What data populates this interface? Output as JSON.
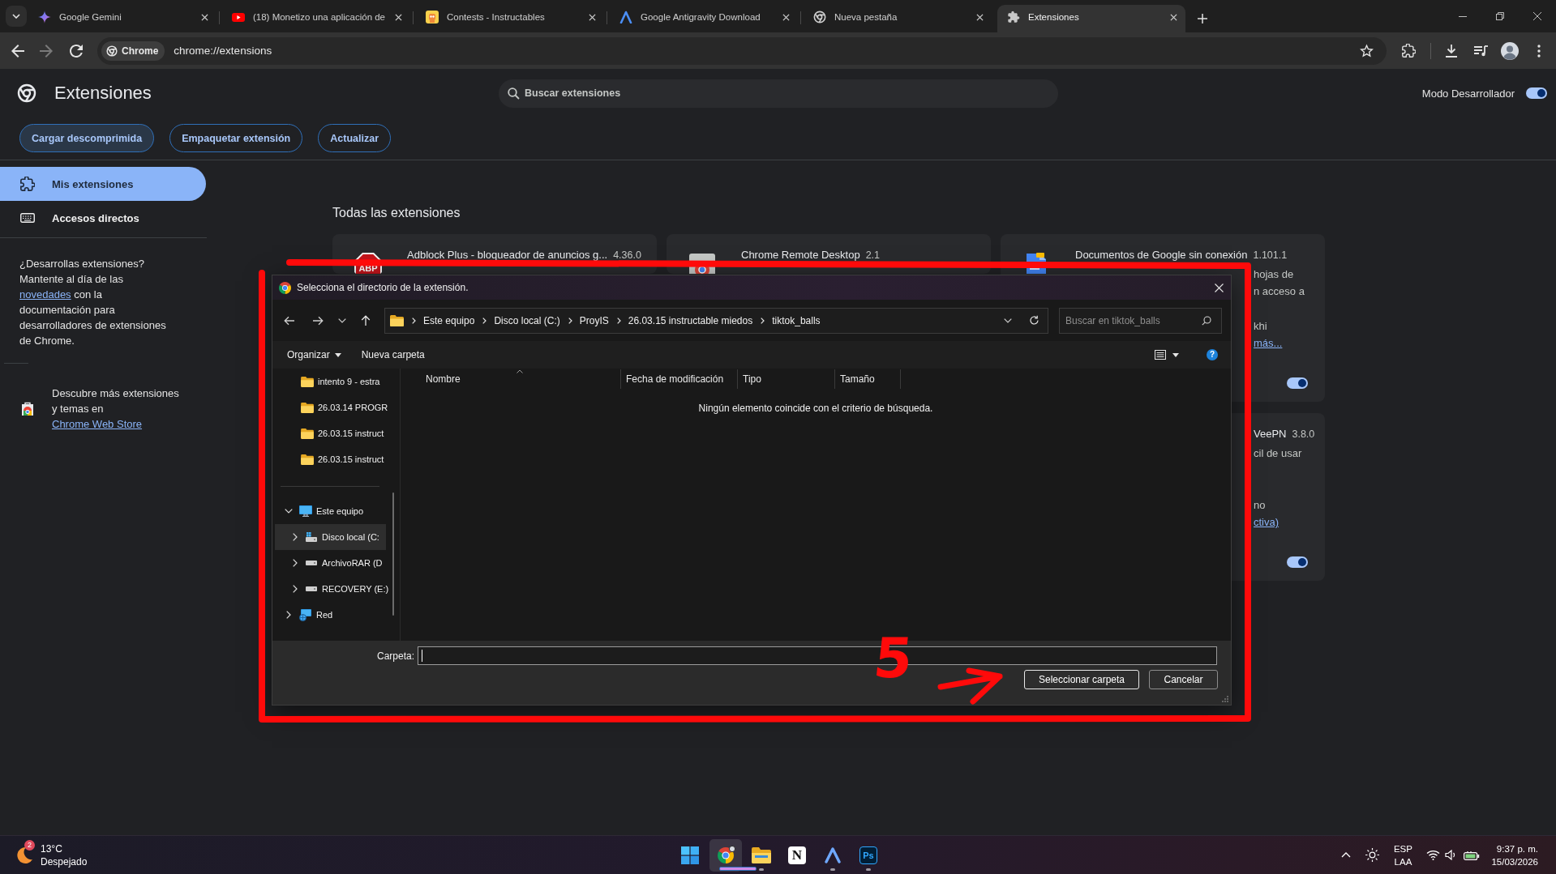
{
  "browser": {
    "tabs": [
      {
        "title": "Google Gemini",
        "selected": false
      },
      {
        "title": "(18) Monetizo una aplicación de",
        "selected": false
      },
      {
        "title": "Contests - Instructables",
        "selected": false
      },
      {
        "title": "Google Antigravity Download",
        "selected": false
      },
      {
        "title": "Nueva pestaña",
        "selected": false
      },
      {
        "title": "Extensiones",
        "selected": true
      }
    ],
    "nav_buttons": [
      {
        "kind": "back",
        "disabled": false
      },
      {
        "kind": "forward",
        "disabled": true
      },
      {
        "kind": "reload",
        "disabled": false
      }
    ],
    "omnibox": {
      "chip": "Chrome",
      "url": "chrome://extensions"
    }
  },
  "extensions_page": {
    "title": "Extensiones",
    "search": {
      "placeholder": "Buscar extensiones"
    },
    "developer_mode": {
      "label": "Modo Desarrollador",
      "on": true
    },
    "actions": [
      {
        "label": "Cargar descomprimida",
        "hovered": true
      },
      {
        "label": "Empaquetar extensión",
        "hovered": false
      },
      {
        "label": "Actualizar",
        "hovered": false
      }
    ],
    "sidebar": {
      "items": [
        {
          "label": "Mis extensiones",
          "selected": true
        },
        {
          "label": "Accesos directos",
          "selected": false
        }
      ],
      "developer_note": {
        "text_before": "¿Desarrollas extensiones? Mantente al día de las",
        "link": "novedades",
        "text_after": "con la documentación para desarrolladores de extensiones de Chrome."
      },
      "store_note": {
        "text_before": "Descubre más extensiones y temas en",
        "link": "Chrome Web Store"
      }
    },
    "section_title": "Todas las extensiones",
    "cards": [
      {
        "kind": "top",
        "name": "Adblock Plus - bloqueador de anuncios g...",
        "version": "4.36.0",
        "logo_text": "ABP"
      },
      {
        "kind": "top",
        "name": "Chrome Remote Desktop",
        "version": "2.1"
      },
      {
        "kind": "right",
        "name": "Documentos de Google sin conexión",
        "version": "1.101.1",
        "description": [
          "hojas de",
          "n acceso a"
        ],
        "details": [
          "khi"
        ],
        "link": "más...",
        "on": true
      },
      {
        "kind": "right-only",
        "name": "VeePN",
        "version": "3.8.0",
        "description": [
          "cil de usar"
        ],
        "details": [
          "no"
        ],
        "link": "ctiva)",
        "on": true
      }
    ]
  },
  "file_dialog": {
    "title": "Selecciona el directorio de la extensión.",
    "breadcrumb": [
      "Este equipo",
      "Disco local (C:)",
      "ProyIS",
      "26.03.15 instructable miedos",
      "tiktok_balls"
    ],
    "search": {
      "placeholder": "Buscar en tiktok_balls"
    },
    "commands": [
      {
        "label": "Organizar",
        "kind": "menu"
      },
      {
        "label": "Nueva carpeta",
        "kind": "button"
      }
    ],
    "help_glyph": "?",
    "quick_access": [
      {
        "label": "intento 9 - estra",
        "selected": false
      },
      {
        "label": "26.03.14 PROGR",
        "selected": false
      },
      {
        "label": "26.03.15 instruct",
        "selected": false
      },
      {
        "label": "26.03.15 instruct",
        "selected": false
      }
    ],
    "tree": [
      {
        "label": "Este equipo",
        "kind": "computer",
        "expanded": true,
        "selected": false,
        "children": [
          {
            "label": "Disco local (C:",
            "kind": "system-drive",
            "expanded": false,
            "selected": true
          },
          {
            "label": "ArchivoRAR (D",
            "kind": "drive",
            "expanded": false,
            "selected": false
          },
          {
            "label": "RECOVERY (E:)",
            "kind": "drive",
            "expanded": false,
            "selected": false
          }
        ]
      },
      {
        "label": "Red",
        "kind": "network",
        "expanded": false,
        "selected": false
      }
    ],
    "columns": [
      {
        "label": "Nombre",
        "sorted": true
      },
      {
        "label": "Fecha de modificación",
        "sorted": false
      },
      {
        "label": "Tipo",
        "sorted": false
      },
      {
        "label": "Tamaño",
        "sorted": false
      }
    ],
    "empty_message": "Ningún elemento coincide con el criterio de búsqueda.",
    "folder_field": {
      "label": "Carpeta:"
    },
    "buttons": [
      {
        "label": "Seleccionar carpeta",
        "default": true
      },
      {
        "label": "Cancelar",
        "default": false
      }
    ]
  },
  "annotation": {
    "step_number": "5"
  },
  "taskbar": {
    "weather": {
      "badge": "2",
      "temperature": "13°C",
      "condition": "Despejado"
    },
    "apps": [
      {
        "kind": "start",
        "selected": false,
        "running": false
      },
      {
        "kind": "chrome",
        "selected": true,
        "running": true
      },
      {
        "kind": "explorer",
        "selected": false,
        "running": true
      },
      {
        "kind": "notion",
        "glyph": "N",
        "selected": false,
        "running": false
      },
      {
        "kind": "antigravity",
        "selected": false,
        "running": true
      },
      {
        "kind": "photoshop",
        "glyph": "Ps",
        "selected": false,
        "running": true
      }
    ],
    "language": [
      "ESP",
      "LAA"
    ],
    "time": "9:37 p. m.",
    "date": "15/03/2026"
  }
}
